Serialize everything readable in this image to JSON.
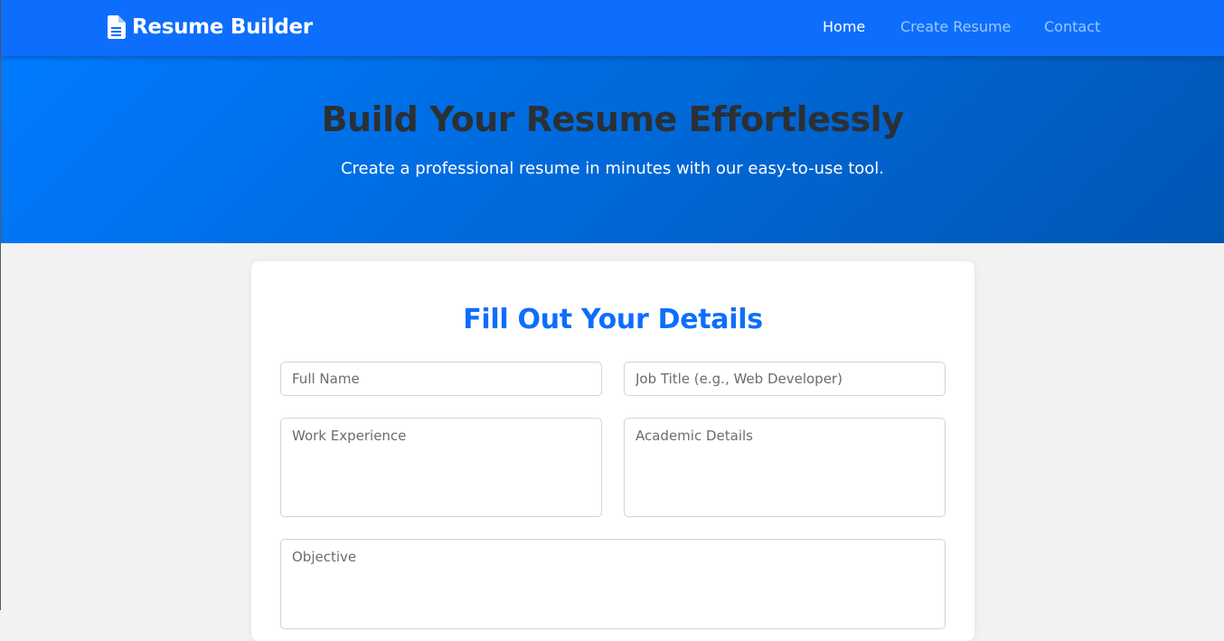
{
  "navbar": {
    "brand": "Resume Builder",
    "brand_icon": "file-document-icon",
    "links": [
      {
        "label": "Home",
        "active": true
      },
      {
        "label": "Create Resume",
        "active": false
      },
      {
        "label": "Contact",
        "active": false
      }
    ]
  },
  "hero": {
    "title": "Build Your Resume Effortlessly",
    "subtitle": "Create a professional resume in minutes with our easy-to-use tool."
  },
  "form": {
    "title": "Fill Out Your Details",
    "full_name": {
      "placeholder": "Full Name",
      "value": ""
    },
    "job_title": {
      "placeholder": "Job Title (e.g., Web Developer)",
      "value": ""
    },
    "work_experience": {
      "placeholder": "Work Experience",
      "value": ""
    },
    "academic_details": {
      "placeholder": "Academic Details",
      "value": ""
    },
    "objective": {
      "placeholder": "Objective",
      "value": ""
    }
  },
  "colors": {
    "primary": "#0d6efd",
    "hero_gradient_start": "#007bff",
    "hero_gradient_end": "#0056b3",
    "hero_title": "#2b3035",
    "page_background": "#f2f2f2"
  }
}
